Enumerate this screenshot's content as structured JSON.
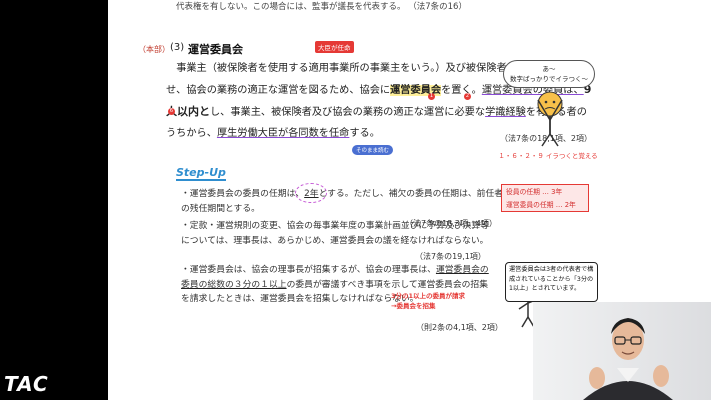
{
  "top": {
    "partial_line": "代表権を有しない。この場合には、監事が議長を代表する。",
    "ref": "（法7条の16）"
  },
  "section": {
    "tag": "（本部）",
    "number": "(3)",
    "title": "運営委員会"
  },
  "annotations": {
    "daijin": "大臣が任命",
    "circle1": "1",
    "circle2": "2",
    "circle6": "6",
    "sonomama": "そのまま読む"
  },
  "paragraph": {
    "p1": "事業主（被保険者を使用する適用事業所の事業主をいう。）及び被保険者の意見を反映させ、協会の業務の適正な運営を図るため、協会に",
    "p1_hl": "運営委員会",
    "p2": "を置く。",
    "p2_u": "運営委員会の委員は、",
    "p2_big": "9人以内と",
    "p3": "し、事業主、被保険者及び協会の業務の適正な運営に必要な",
    "p3_u": "学識経験",
    "p4": "を有する者のうちから、",
    "p4_u": "厚生労働大臣が各同数を任命",
    "p5": "する。",
    "ref": "（法7条の18,1項、2項）"
  },
  "stepup": {
    "label": "Step-Up",
    "items": [
      {
        "text_a": "・運営委員会の委員の任期は、",
        "text_u": "2年",
        "text_b": "とする。ただし、補欠の委員の任期は、前任者の残任期間とする。",
        "ref": "（法7条の18,3項、4項）"
      },
      {
        "text_a": "・定款・運営規則の変更、協会の毎事業年度の事業計画並びに予算及び決算等については、理事長は、あらかじめ、運営委員会の",
        "text_u": "議を経なければならない。",
        "text_b": "",
        "ref": "（法7条の19,1項）"
      },
      {
        "text_a": "・運営委員会は、協会の理事長が招集するが、協会の理事長は、",
        "text_u": "運営委員会の委員の総数の３分の１以上",
        "text_b": "の委員が審議すべき事項を示して運営委員会の招集を請求したときは、運営委員会を招集しなければならない。",
        "ref": "（則2条の4,1項、2項）"
      }
    ]
  },
  "redbox": {
    "line1": "役員の任期 … 3年",
    "line2": "運営委員の任期 … 2年"
  },
  "note3": {
    "line1": "3分の1以上の委員が請求",
    "line2": "→委員会を招集"
  },
  "sidebar": {
    "speech": "あ～\n数字ばっかりでイラつく～",
    "caption": "１・６・２・９ イラつくと覚える",
    "panel": "運営委員会は3者の代表者で構成されていることから「3分の1以上」とされています。"
  },
  "brand": {
    "logo": "TAC"
  },
  "colors": {
    "accent_red": "#e53935",
    "accent_blue": "#2f8ecf",
    "highlight": "#fff09a",
    "purple_underline": "#8a4bd4"
  }
}
